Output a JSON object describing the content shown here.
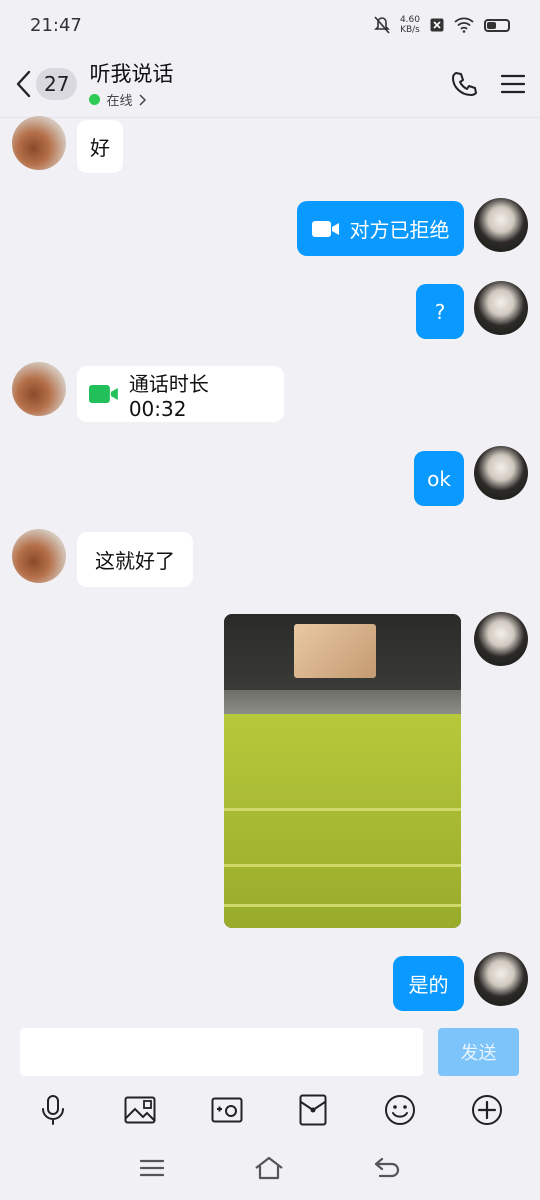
{
  "status": {
    "time": "21:47",
    "speed_value": "4.60",
    "speed_unit": "KB/s"
  },
  "header": {
    "back_icon": "chevron-left-icon",
    "unread_count": "27",
    "title": "听我说话",
    "presence": "在线"
  },
  "messages": [
    {
      "side": "left",
      "type": "text",
      "text": "好"
    },
    {
      "side": "right",
      "type": "video-call",
      "text": "对方已拒绝"
    },
    {
      "side": "right",
      "type": "text",
      "text": "?"
    },
    {
      "side": "left",
      "type": "video-call",
      "text": "通话时长 00:32"
    },
    {
      "side": "right",
      "type": "text",
      "text": "ok"
    },
    {
      "side": "left",
      "type": "text",
      "text": "这就好了"
    },
    {
      "side": "right",
      "type": "image",
      "text": ""
    },
    {
      "side": "right",
      "type": "text",
      "text": "是的"
    }
  ],
  "composer": {
    "input_value": "",
    "send_label": "发送"
  },
  "toolbar": [
    "mic-icon",
    "image-icon",
    "camera-icon",
    "red-packet-icon",
    "emoji-icon",
    "plus-icon"
  ],
  "colors": {
    "bubble_right": "#0a99ff",
    "bubble_left": "#ffffff",
    "online": "#2ecc55",
    "video_green": "#22c05a"
  }
}
